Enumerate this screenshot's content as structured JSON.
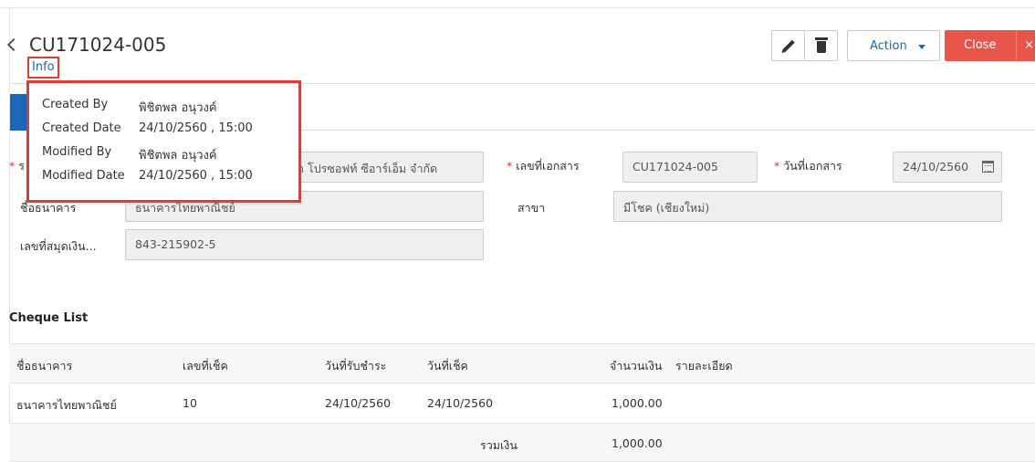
{
  "header": {
    "doc_number": "CU171024-005",
    "info_link": "Info",
    "action_label": "Action",
    "close_label": "Close",
    "close_x": "×"
  },
  "info_popup": {
    "created_by_label": "Created By",
    "created_by": "พิชิตพล อนุวงค์",
    "created_date_label": "Created Date",
    "created_date": "24/10/2560 , 15:00",
    "modified_by_label": "Modified By",
    "modified_by": "พิชิตพล อนุวงค์",
    "modified_date_label": "Modified Date",
    "modified_date": "24/10/2560 , 15:00"
  },
  "form": {
    "req_mark": "*",
    "customer_label_partial": "ร",
    "customer_value": "า โปรซอฟท์ ซีอาร์เอ็ม จำกัด",
    "doc_no_label": "เลขที่เอกสาร",
    "doc_no_value": "CU171024-005",
    "doc_date_label": "วันที่เอกสาร",
    "doc_date_value": "24/10/2560",
    "bank_label": "ชื่อธนาคาร",
    "bank_value": "ธนาคารไทยพาณิชย์",
    "branch_label": "สาขา",
    "branch_value": "มีโชค (เชียงใหม่)",
    "account_label": "เลขที่สมุดเงิน...",
    "account_value": "843-215902-5"
  },
  "cheque_list": {
    "title": "Cheque List",
    "columns": [
      "ชื่อธนาคาร",
      "เลขที่เช็ค",
      "วันที่รับชำระ",
      "วันที่เช็ค",
      "จำนวนเงิน",
      "รายละเอียด"
    ],
    "rows": [
      [
        "ธนาคารไทยพาณิชย์",
        "10",
        "24/10/2560",
        "24/10/2560",
        "1,000.00",
        ""
      ]
    ],
    "total_label": "รวมเงิน",
    "total_value": "1,000.00"
  },
  "colors": {
    "accent": "#1a67b8",
    "close": "#e8554b",
    "highlight": "#e53935"
  }
}
